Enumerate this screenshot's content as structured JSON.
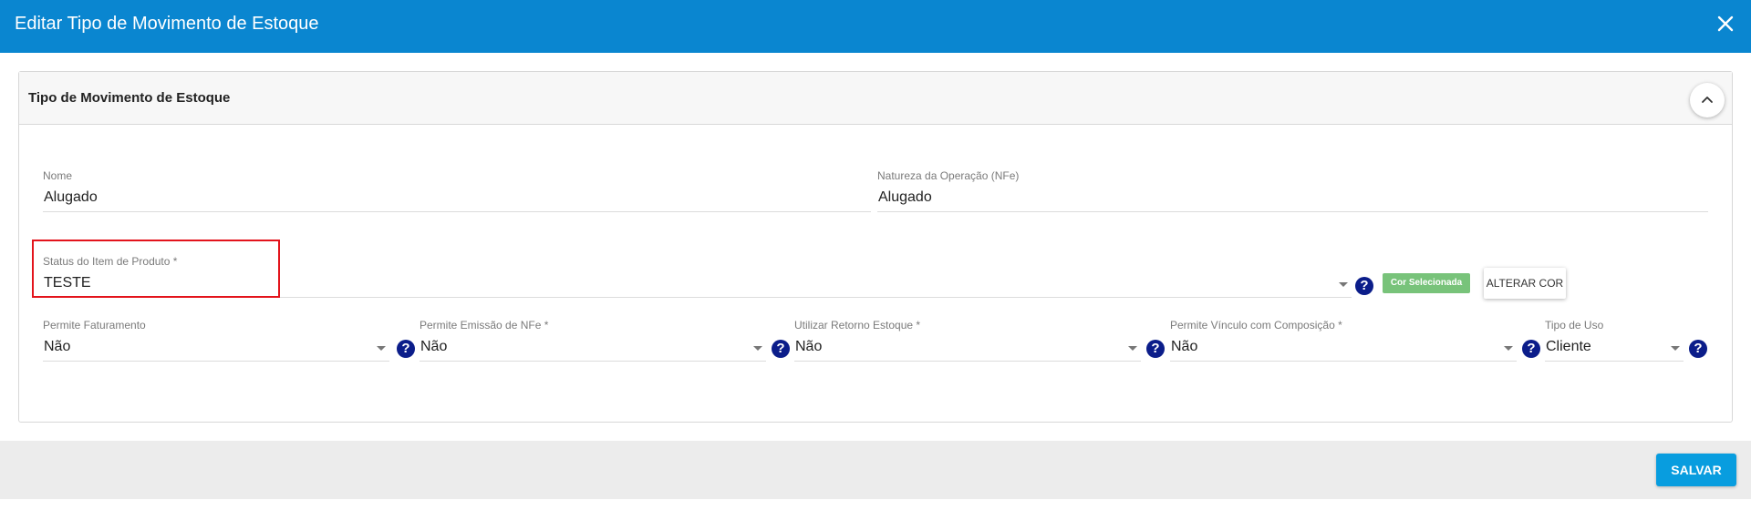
{
  "dialog": {
    "title": "Editar Tipo de Movimento de Estoque",
    "close_icon": "close-icon"
  },
  "section": {
    "title": "Tipo de Movimento de Estoque",
    "collapse_icon": "chevron-up-icon"
  },
  "fields": {
    "nome": {
      "label": "Nome",
      "value": "Alugado"
    },
    "natureza": {
      "label": "Natureza da Operação (NFe)",
      "value": "Alugado"
    },
    "status": {
      "label": "Status do Item de Produto *",
      "value": "TESTE"
    },
    "faturamento": {
      "label": "Permite Faturamento",
      "value": "Não"
    },
    "emissao": {
      "label": "Permite Emissão de NFe *",
      "value": "Não"
    },
    "retorno": {
      "label": "Utilizar Retorno Estoque *",
      "value": "Não"
    },
    "vinculo": {
      "label": "Permite Vínculo com Composição *",
      "value": "Não"
    },
    "uso": {
      "label": "Tipo de Uso",
      "value": "Cliente"
    }
  },
  "help_glyph": "?",
  "color_badge": {
    "label": "Cor Selecionada",
    "color": "#78c37a"
  },
  "alter_color_button": "ALTERAR COR",
  "footer": {
    "save_label": "SALVAR"
  },
  "colors": {
    "header": "#0a86d0",
    "save": "#089ddf",
    "help": "#0b1d8a",
    "highlight": "#e3141c"
  }
}
